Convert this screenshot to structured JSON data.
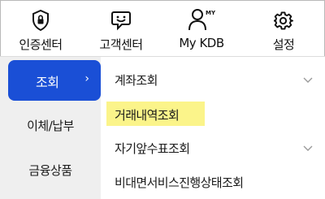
{
  "top_nav": {
    "items": [
      {
        "label": "인증센터",
        "icon": "shield-lock-icon"
      },
      {
        "label": "고객센터",
        "icon": "chat-bubble-icon"
      },
      {
        "label": "My KDB",
        "icon": "user-my-icon",
        "badge": "MY"
      },
      {
        "label": "설정",
        "icon": "gear-icon"
      }
    ]
  },
  "left_nav": {
    "items": [
      {
        "label": "조회",
        "active": true,
        "chevron": "›"
      },
      {
        "label": "이체/납부"
      },
      {
        "label": "금융상품"
      }
    ]
  },
  "submenu": {
    "items": [
      {
        "label": "계좌조회",
        "expandable": true
      },
      {
        "label": "거래내역조회",
        "highlighted": true
      },
      {
        "label": "자기앞수표조회",
        "expandable": true
      },
      {
        "label": "비대면서비스진행상태조회"
      }
    ]
  },
  "colors": {
    "accent": "#1a4fd6",
    "highlight": "#fbf48a",
    "left_nav_bg": "#efefef"
  }
}
